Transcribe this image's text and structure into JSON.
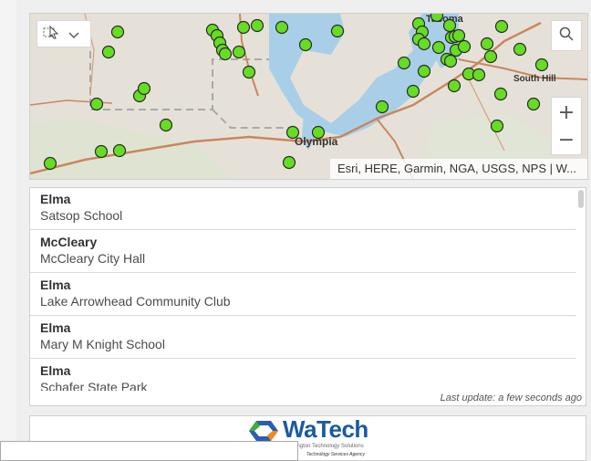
{
  "map": {
    "labels": {
      "tacoma": "Tacoma",
      "olympia": "Olympia",
      "south_hill": "South Hill"
    },
    "attribution": "Esri, HERE, Garmin, NGA, USGS, NPS | W...",
    "zoom_in": "+",
    "zoom_out": "−",
    "marker_color": "#66dd22"
  },
  "list": {
    "items": [
      {
        "title": "Elma",
        "subtitle": "Satsop School"
      },
      {
        "title": "McCleary",
        "subtitle": "McCleary City Hall"
      },
      {
        "title": "Elma",
        "subtitle": "Lake Arrowhead Community Club"
      },
      {
        "title": "Elma",
        "subtitle": "Mary M Knight School"
      },
      {
        "title": "Elma",
        "subtitle": "Schafer State Park"
      }
    ],
    "last_update": "Last update: a few seconds ago"
  },
  "logo": {
    "name": "WaTech",
    "line1": "Washington Technology Solutions",
    "line2": "Technology Services Agency"
  }
}
